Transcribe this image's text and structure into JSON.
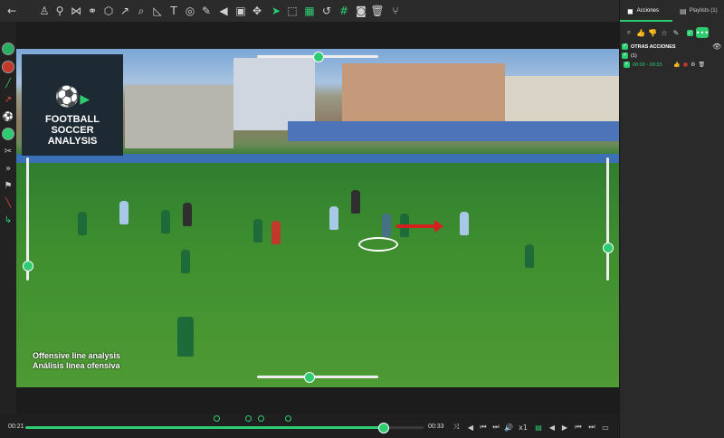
{
  "toolbar": {
    "icons": [
      "back-arrow-icon",
      "player-icon",
      "player-run-icon",
      "share-nodes-icon",
      "connect-icon",
      "hexagon-icon",
      "arrow-diagonal-icon",
      "search-icon",
      "triangle-ruler-icon",
      "text-icon",
      "target-icon",
      "pencil-icon",
      "spotlight-icon",
      "image-icon",
      "move-icon",
      "cursor-icon",
      "frame-icon",
      "frame-check-icon",
      "undo-icon",
      "grid-icon",
      "camera-icon",
      "trash-icon",
      "merge-icon"
    ]
  },
  "leftbar": {
    "icons": [
      "green-circle-icon",
      "red-circle-icon",
      "line-icon",
      "arrow-red-icon",
      "kick-icon",
      "green-disc-icon",
      "player-cut-icon",
      "sprint-icon",
      "runner-icon",
      "eraser-icon",
      "green-arrow-icon"
    ]
  },
  "video": {
    "logo_line1": "FOOTBALL",
    "logo_line2": "SOCCER",
    "logo_line3": "ANALYSIS",
    "caption_line1": "Offensive line analysis",
    "caption_line2": "Análisis línea ofensiva"
  },
  "timeline": {
    "current_time": "00:21",
    "end_time": "00:33",
    "progress": 0.9,
    "markers": [
      0.48,
      0.56,
      0.59,
      0.66
    ],
    "speed": "x1"
  },
  "right_panel": {
    "tab_actions": "Acciones",
    "tab_playlists": "Playlists (1)",
    "group_title": "OTRAS ACCIONES",
    "group_count": "(1)",
    "clip_range": "00:00 - 00:33"
  },
  "colors": {
    "accent": "#2ecc71",
    "panel": "#2a2a2a",
    "background": "#262626"
  }
}
